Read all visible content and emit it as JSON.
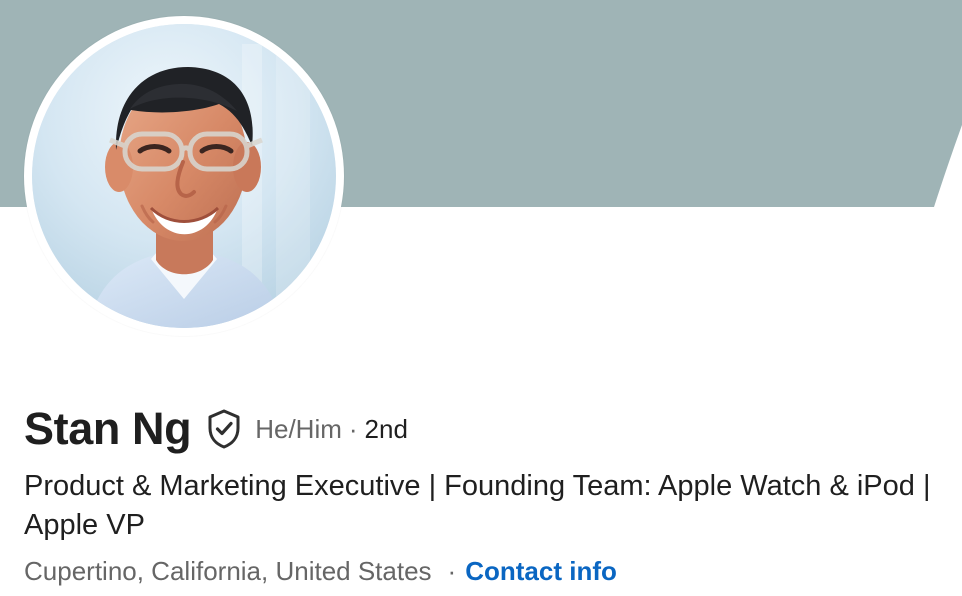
{
  "profile": {
    "name": "Stan Ng",
    "pronouns": "He/Him",
    "separator": "·",
    "connection_degree": "2nd",
    "headline": "Product & Marketing Executive | Founding Team: Apple Watch & iPod | Apple VP",
    "location": "Cupertino, California, United States",
    "location_separator": "·",
    "contact_info": "Contact info"
  },
  "icons": {
    "verified": "shield-check-icon"
  },
  "colors": {
    "banner": "#9fb4b6",
    "text": "#1f1f1f",
    "muted_text": "#666666",
    "link": "#0a66c2",
    "background": "#ffffff"
  }
}
